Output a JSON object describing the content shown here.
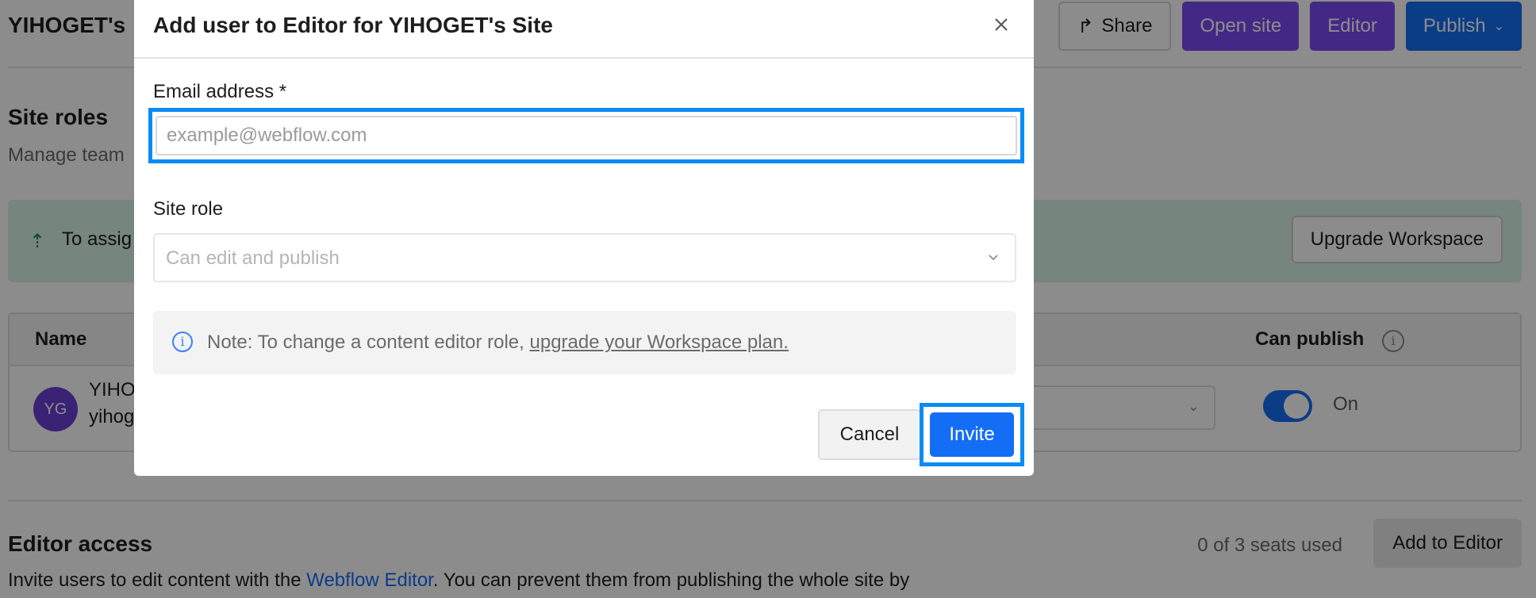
{
  "background": {
    "title": "YIHOGET's",
    "share_label": "Share",
    "open_site_label": "Open site",
    "editor_label": "Editor",
    "publish_label": "Publish",
    "site_roles_heading": "Site roles",
    "site_roles_sub": "Manage team",
    "banner_text": "To assig",
    "upgrade_label": "Upgrade Workspace",
    "table": {
      "col_name": "Name",
      "col_can_publish": "Can publish",
      "avatar_initials": "YG",
      "user_name": "YIHOG",
      "user_email": "yihog",
      "toggle_label": "On"
    },
    "editor_access_heading": "Editor access",
    "seats_text": "0 of 3 seats used",
    "add_to_editor_label": "Add to Editor",
    "editor_desc_before": "Invite users to edit content with the ",
    "editor_desc_link": "Webflow Editor",
    "editor_desc_after": ". You can prevent them from publishing the whole site by"
  },
  "modal": {
    "title": "Add user to Editor for YIHOGET's Site",
    "email_label": "Email address *",
    "email_placeholder": "example@webflow.com",
    "email_value": "",
    "role_label": "Site role",
    "role_value": "Can edit and publish",
    "note_prefix": "Note: To change a content editor role, ",
    "note_link": "upgrade your Workspace plan.",
    "cancel_label": "Cancel",
    "invite_label": "Invite"
  },
  "colors": {
    "accent_blue": "#146ef5",
    "highlight_blue": "#0b8cf5",
    "purple": "#7b49f3",
    "banner_green": "#d7f3e4"
  }
}
